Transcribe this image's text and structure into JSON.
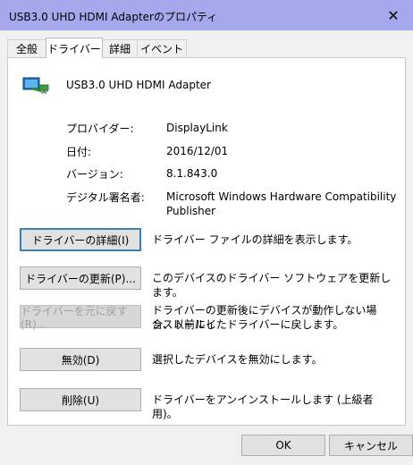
{
  "window": {
    "title": "USB3.0 UHD HDMI Adapterのプロパティ",
    "close_glyph": "✕"
  },
  "tabs": [
    {
      "label": "全般"
    },
    {
      "label": "ドライバー"
    },
    {
      "label": "詳細"
    },
    {
      "label": "イベント"
    }
  ],
  "device": {
    "name": "USB3.0 UHD HDMI Adapter",
    "icon": "display-adapter-icon"
  },
  "info": {
    "provider_label": "プロバイダー:",
    "provider_value": "DisplayLink",
    "date_label": "日付:",
    "date_value": "2016/12/01",
    "version_label": "バージョン:",
    "version_value": "8.1.843.0",
    "signer_label": "デジタル署名者:",
    "signer_value_line1": "Microsoft Windows Hardware Compatibility",
    "signer_value_line2": "Publisher"
  },
  "actions": [
    {
      "button": "ドライバーの詳細(I)",
      "desc1": "ドライバー ファイルの詳細を表示します。",
      "desc2": ""
    },
    {
      "button": "ドライバーの更新(P)...",
      "desc1": "このデバイスのドライバー ソフトウェアを更新します。",
      "desc2": ""
    },
    {
      "button": "ドライバーを元に戻す(R)...",
      "desc1": "ドライバーの更新後にデバイスが動作しない場合、以前にイ",
      "desc2": "ンストールしたドライバーに戻します。"
    },
    {
      "button": "無効(D)",
      "desc1": "選択したデバイスを無効にします。",
      "desc2": ""
    },
    {
      "button": "削除(U)",
      "desc1": "ドライバーをアンインストールします (上級者用)。",
      "desc2": ""
    }
  ],
  "footer": {
    "ok": "OK",
    "cancel": "キャンセル"
  }
}
